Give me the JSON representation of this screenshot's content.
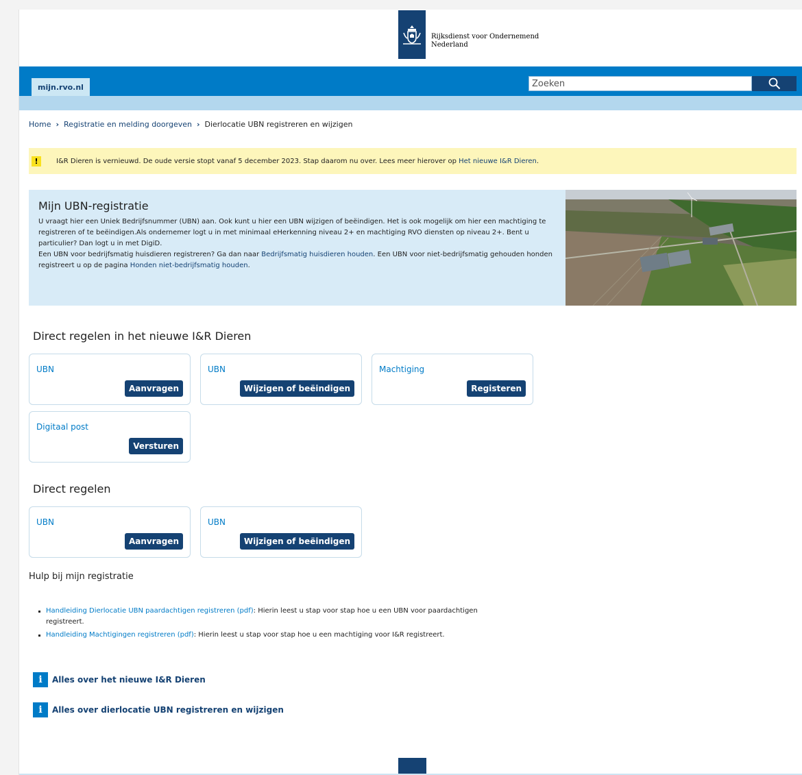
{
  "header": {
    "org_line1": "Rijksdienst voor Ondernemend",
    "org_line2": "Nederland",
    "site_tab": "mijn.rvo.nl",
    "search_placeholder": "Zoeken"
  },
  "breadcrumb": {
    "items": [
      "Home",
      "Registratie en melding doorgeven"
    ],
    "current": "Dierlocatie UBN registreren en wijzigen"
  },
  "alert": {
    "text": "I&R Dieren is vernieuwd. De oude versie stopt vanaf 5 december 2023. Stap daarom nu over. Lees meer hierover op ",
    "link": "Het nieuwe I&R Dieren",
    "suffix": "."
  },
  "hero": {
    "title": "Mijn UBN-registratie",
    "p1": "U vraagt hier een Uniek Bedrijfsnummer (UBN) aan. Ook kunt u hier een UBN wijzigen of beëindigen. Het is ook mogelijk om hier een machtiging te registreren of te beëindigen.Als ondernemer logt u in met minimaal eHerkenning niveau 2+ en machtiging RVO diensten op niveau 2+. Bent u particulier? Dan logt u in met DigiD.",
    "p2_pre": "Een UBN voor bedrijfsmatig huisdieren registreren? Ga dan naar ",
    "p2_link1": "Bedrijfsmatig huisdieren houden",
    "p2_mid": ". Een UBN voor niet-bedrijfsmatig gehouden honden registreert u op de pagina ",
    "p2_link2": "Honden niet-bedrijfsmatig houden",
    "p2_end": "."
  },
  "section_new": {
    "title": "Direct regelen in het nieuwe I&R Dieren",
    "cards": [
      {
        "label": "UBN",
        "button": "Aanvragen"
      },
      {
        "label": "UBN",
        "button": "Wijzigen of beëindigen"
      },
      {
        "label": "Machtiging",
        "button": "Registeren"
      },
      {
        "label": "Digitaal post",
        "button": "Versturen"
      }
    ]
  },
  "section_direct": {
    "title": "Direct regelen",
    "cards": [
      {
        "label": "UBN",
        "button": "Aanvragen"
      },
      {
        "label": "UBN",
        "button": "Wijzigen of beëindigen"
      }
    ]
  },
  "help": {
    "title": "Hulp bij mijn registratie",
    "items": [
      {
        "link": "Handleiding Dierlocatie UBN paardachtigen registreren (pdf)",
        "text": ": Hierin leest u stap voor stap hoe u een UBN voor paardachtigen registreert."
      },
      {
        "link": "Handleiding Machtigingen registreren (pdf)",
        "text": ": Hierin leest u stap voor stap hoe u een machtiging voor I&R registreert."
      }
    ]
  },
  "info_links": [
    {
      "icon": "info-icon",
      "text": "Alles over het nieuwe I&R Dieren"
    },
    {
      "icon": "info-icon",
      "text": "Alles over dierlocatie UBN registreren en wijzigen"
    }
  ],
  "colors": {
    "brand_dark": "#154273",
    "brand_blue": "#007bc7",
    "light_blue": "#b3d7ee",
    "hero_bg": "#d8ebf7",
    "alert_bg": "#fdf6bb"
  }
}
